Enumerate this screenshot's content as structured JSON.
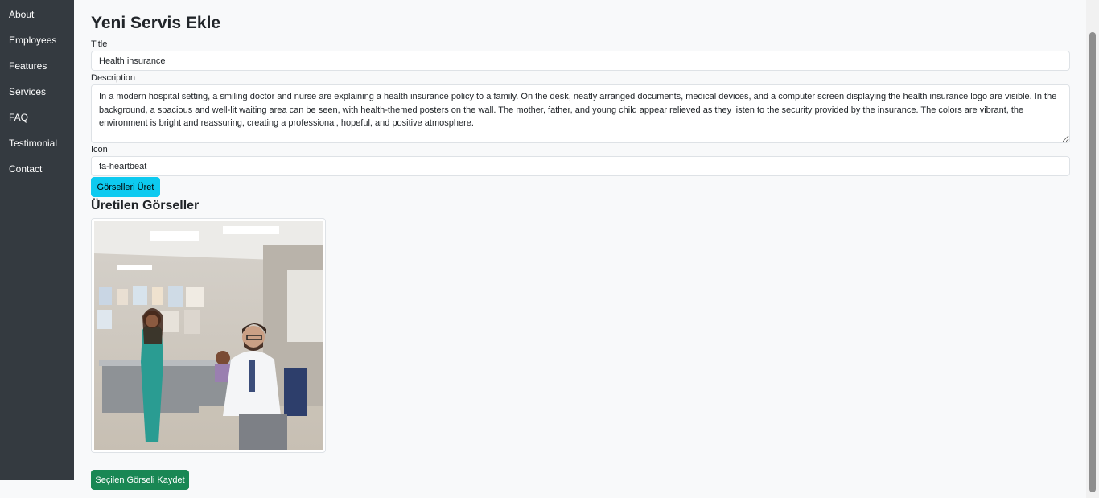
{
  "sidebar": {
    "items": [
      {
        "label": "About"
      },
      {
        "label": "Employees"
      },
      {
        "label": "Features"
      },
      {
        "label": "Services"
      },
      {
        "label": "FAQ"
      },
      {
        "label": "Testimonial"
      },
      {
        "label": "Contact"
      }
    ]
  },
  "form": {
    "page_title": "Yeni Servis Ekle",
    "title_label": "Title",
    "title_value": "Health insurance",
    "description_label": "Description",
    "description_value": "In a modern hospital setting, a smiling doctor and nurse are explaining a health insurance policy to a family. On the desk, neatly arranged documents, medical devices, and a computer screen displaying the health insurance logo are visible. In the background, a spacious and well-lit waiting area can be seen, with health-themed posters on the wall. The mother, father, and young child appear relieved as they listen to the security provided by the insurance. The colors are vibrant, the environment is bright and reassuring, creating a professional, hopeful, and positive atmosphere.",
    "icon_label": "Icon",
    "icon_value": "fa-heartbeat",
    "generate_button": "Görselleri Üret",
    "generated_title": "Üretilen Görseller",
    "save_button": "Seçilen Görseli Kaydet"
  },
  "colors": {
    "sidebar_bg": "#343a40",
    "info": "#0dcaf0",
    "success": "#198754"
  }
}
